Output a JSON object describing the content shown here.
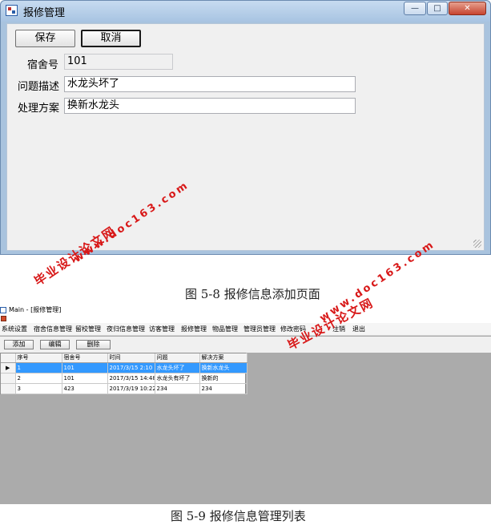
{
  "add_window": {
    "title": "报修管理",
    "buttons": {
      "save": "保存",
      "cancel": "取消"
    },
    "window_controls": {
      "minimize": "—",
      "maximize": "□",
      "close": "✕"
    },
    "fields": {
      "dorm_label": "宿舍号",
      "dorm_value": "101",
      "problem_label": "问题描述",
      "problem_value": "水龙头坏了",
      "solution_label": "处理方案",
      "solution_value": "换新水龙头"
    }
  },
  "caption_1": "图 5-8 报修信息添加页面",
  "list_window": {
    "title": "Main - [报修管理]",
    "menu": [
      "系统设置",
      "宿舍信息管理",
      "留校管理",
      "夜归信息管理",
      "访客管理",
      "报修管理",
      "物品管理",
      "管理员管理",
      "修改密码",
      "注销",
      "退出"
    ],
    "toolbar": {
      "add": "添加",
      "edit": "编辑",
      "delete": "删除"
    },
    "table": {
      "columns": [
        "序号",
        "宿舍号",
        "时间",
        "问题",
        "解决方案"
      ],
      "rows": [
        [
          "1",
          "101",
          "2017/3/15 2:10",
          "水龙头坏了",
          "换新水龙头"
        ],
        [
          "2",
          "101",
          "2017/3/15 14:48",
          "水龙头有坏了",
          "换新的"
        ],
        [
          "3",
          "423",
          "2017/3/19 10:22",
          "234",
          "234"
        ]
      ],
      "selected_row": 0,
      "row_marker": "▶"
    }
  },
  "caption_2": "图 5-9 报修信息管理列表",
  "watermark": {
    "site_cn": "毕业设计论文网",
    "site_url": "www.doc163.com"
  }
}
